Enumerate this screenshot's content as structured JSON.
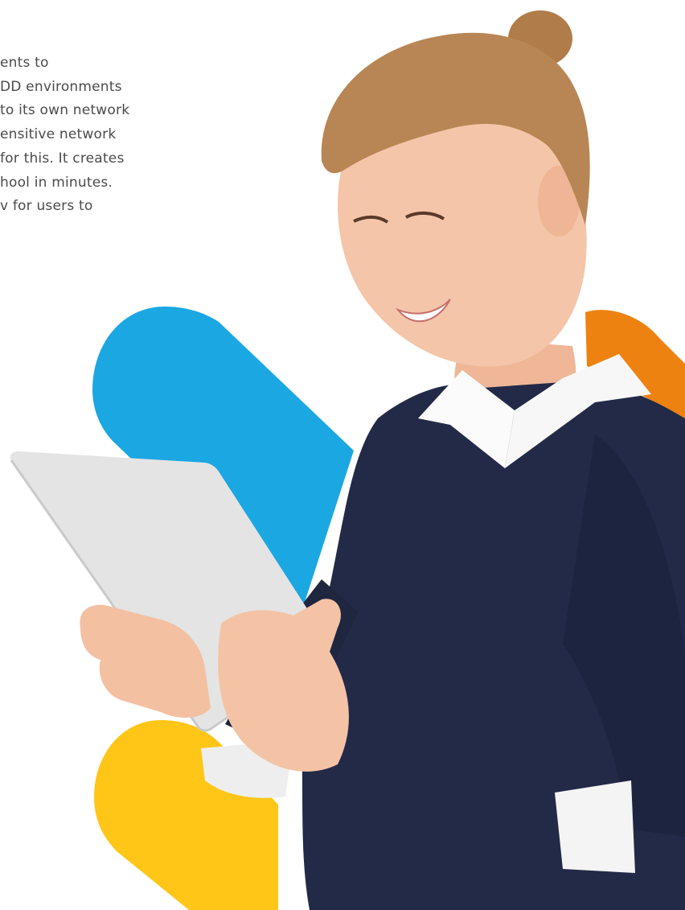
{
  "text_lines": [
    "ents to",
    "DD environments",
    "to its own network",
    "ensitive network",
    "for this. It creates",
    "hool in minutes.",
    "v for users to"
  ],
  "colors": {
    "blue_shape": "#1ba7e1",
    "orange_shape": "#ee8211",
    "yellow_shape": "#ffc617",
    "sweater": "#222a47",
    "collar": "#fbfbfb",
    "tablet": "#e4e4e4",
    "skin": "#f3c3a8",
    "hair": "#b88654",
    "text": "#4a4a4a"
  },
  "icons": {
    "person": "student-with-tablet-photo"
  }
}
